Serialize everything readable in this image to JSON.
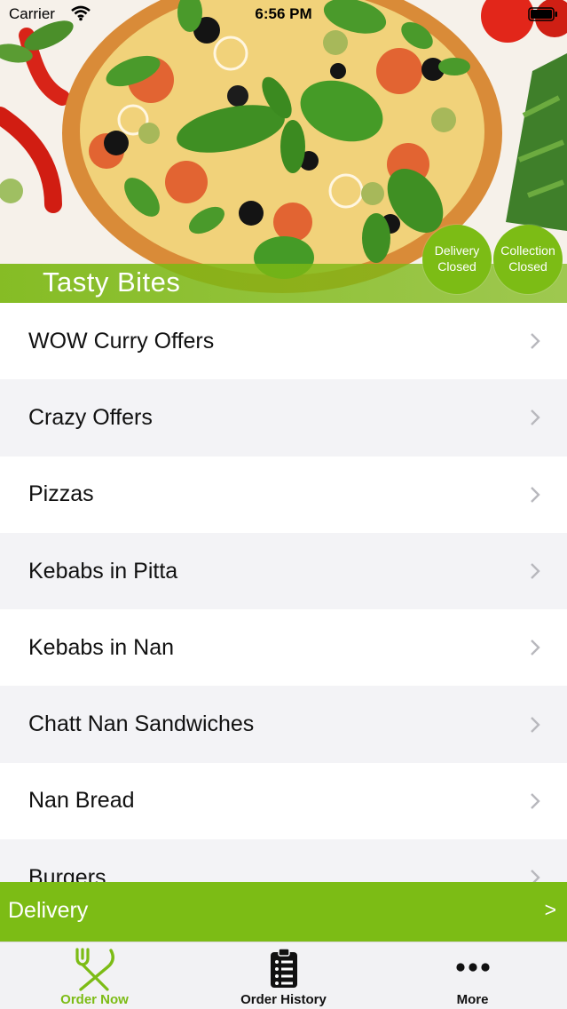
{
  "status_bar": {
    "carrier": "Carrier",
    "time": "6:56 PM"
  },
  "store": {
    "name": "Tasty Bites"
  },
  "badges": {
    "delivery": {
      "line1": "Delivery",
      "line2": "Closed"
    },
    "collection": {
      "line1": "Collection",
      "line2": "Closed"
    }
  },
  "menu": {
    "items": [
      {
        "label": "WOW Curry Offers"
      },
      {
        "label": "Crazy Offers"
      },
      {
        "label": "Pizzas"
      },
      {
        "label": "Kebabs in Pitta"
      },
      {
        "label": "Kebabs in Nan"
      },
      {
        "label": "Chatt Nan Sandwiches"
      },
      {
        "label": "Nan Bread"
      },
      {
        "label": "Burgers"
      }
    ]
  },
  "delivery_bar": {
    "label": "Delivery",
    "arrow": ">"
  },
  "tabs": [
    {
      "label": "Order Now",
      "icon": "fork-knife-icon",
      "active": true
    },
    {
      "label": "Order History",
      "icon": "clipboard-list-icon",
      "active": false
    },
    {
      "label": "More",
      "icon": "more-dots-icon",
      "active": false
    }
  ],
  "colors": {
    "accent": "#7cbc15",
    "row_alt": "#f3f3f6",
    "tab_bg": "#f2f2f4"
  }
}
